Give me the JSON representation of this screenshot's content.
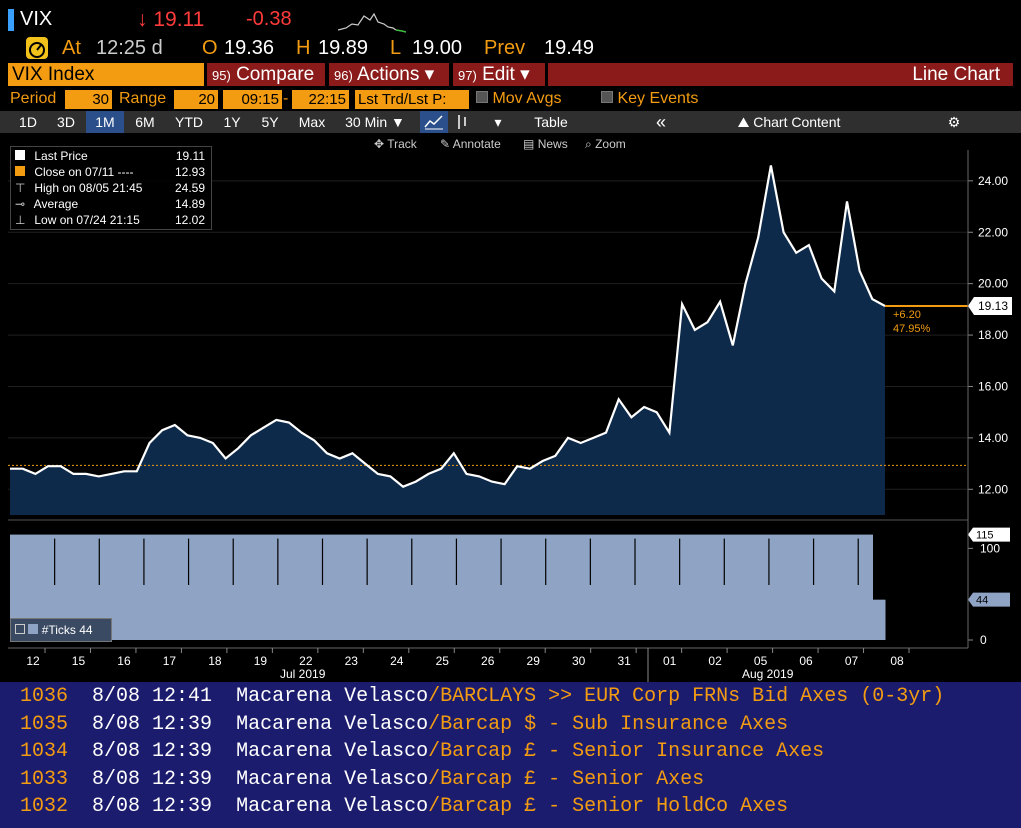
{
  "quote": {
    "ticker": "VIX",
    "last": "↓ 19.11",
    "change": "-0.38",
    "at_label": "At",
    "time": "12:25 d",
    "open_label": "O",
    "open": "19.36",
    "high_label": "H",
    "high": "19.89",
    "low_label": "L",
    "low": "19.00",
    "prev_label": "Prev",
    "prev": "19.49"
  },
  "menu": {
    "security": "VIX Index",
    "compare_num": "95)",
    "compare": "Compare",
    "actions_num": "96)",
    "actions": "Actions ▾",
    "edit_num": "97)",
    "edit": "Edit ▾",
    "chart_type": "Line Chart"
  },
  "period": {
    "period_label": "Period",
    "period_value": "30",
    "range_label": "Range",
    "range_value": "20",
    "start_time": "09:15",
    "dash": "-",
    "end_time": "22:15",
    "mode": "Lst Trd/Lst P:",
    "mov_avgs": "Mov Avgs",
    "key_events": "Key Events"
  },
  "toolbar": {
    "ranges": [
      "1D",
      "3D",
      "1M",
      "6M",
      "YTD",
      "1Y",
      "5Y",
      "Max"
    ],
    "active": "1M",
    "interval": "30 Min ▼",
    "table": "Table",
    "collapse": "«",
    "chart_content": "Chart Content"
  },
  "tools": {
    "track": "Track",
    "annotate": "Annotate",
    "news": "News",
    "zoom": "Zoom"
  },
  "legend": {
    "last_price_label": "Last Price",
    "last_price": "19.11",
    "close_label": "Close on 07/11 ----",
    "close": "12.93",
    "high_label": "High on 08/05 21:45",
    "high": "24.59",
    "average_label": "Average",
    "average": "14.89",
    "low_label": "Low on 07/24 21:15",
    "low": "12.02"
  },
  "annotations": {
    "price_tag": "19.13",
    "change_abs": "+6.20",
    "change_pct": "47.95%",
    "ticks_tag": "115",
    "ticks_current": "44",
    "ticks_legend": "#Ticks 44",
    "month_jul": "Jul 2019",
    "month_aug": "Aug 2019"
  },
  "colors": {
    "accent": "#f39c12",
    "line": "#ffffff",
    "area": "#0e2a4a",
    "volume": "#8fa3c4",
    "news_bg": "#1c1c6e",
    "menu_red": "#8b1a1a"
  },
  "chart_data": {
    "type": "area",
    "title": "",
    "y_axis_ticks": [
      "12.00",
      "14.00",
      "16.00",
      "18.00",
      "20.00",
      "22.00",
      "24.00"
    ],
    "ylim": [
      11,
      25.2
    ],
    "reference_line": {
      "label": "Close on 07/11",
      "value": 12.93
    },
    "x_ticks": [
      "12",
      "15",
      "16",
      "17",
      "18",
      "19",
      "22",
      "23",
      "24",
      "25",
      "26",
      "29",
      "30",
      "31",
      "01",
      "02",
      "05",
      "06",
      "07",
      "08"
    ],
    "x": [
      "12",
      "",
      "15",
      "",
      "16",
      "",
      "17",
      "",
      "18",
      "",
      "19",
      "",
      "22",
      "",
      "23",
      "",
      "24",
      "",
      "25",
      "",
      "26",
      "",
      "29",
      "",
      "30",
      "",
      "31",
      "",
      "01",
      "",
      "02",
      "",
      "05",
      "",
      "06",
      "",
      "07",
      ""
    ],
    "series": [
      {
        "values": [
          12.8,
          12.8,
          12.6,
          12.9,
          12.9,
          12.6,
          12.6,
          12.5,
          12.6,
          12.7,
          12.7,
          13.8,
          14.3,
          14.5,
          14.1,
          14.0,
          13.8,
          13.2,
          13.6,
          14.1,
          14.4,
          14.7,
          14.6,
          14.2,
          13.9,
          13.4,
          13.2,
          13.4,
          13.0,
          12.6,
          12.5,
          12.1,
          12.3,
          12.6,
          12.8,
          13.4,
          12.6,
          12.5,
          12.3,
          12.2,
          12.9,
          12.8,
          13.1,
          13.3,
          14.0,
          13.8,
          14.0,
          14.2,
          15.5,
          14.8,
          15.2,
          15.0,
          14.2,
          19.2,
          18.2,
          18.5,
          19.3,
          17.6,
          20.0,
          21.8,
          24.6,
          22.0,
          21.2,
          21.5,
          20.2,
          19.7,
          23.2,
          20.5,
          19.4,
          19.13
        ]
      }
    ],
    "volume_axis_ticks": [
      "0",
      "100"
    ],
    "volume": {
      "name": "#Ticks",
      "values": [
        115,
        115,
        115,
        115,
        115,
        115,
        115,
        115,
        115,
        115,
        115,
        115,
        115,
        115,
        115,
        115,
        115,
        115,
        115,
        115,
        115,
        115,
        115,
        115,
        115,
        115,
        115,
        115,
        115,
        115,
        115,
        115,
        115,
        115,
        115,
        115,
        115,
        115,
        115,
        115,
        115,
        115,
        115,
        115,
        115,
        115,
        115,
        115,
        115,
        115,
        115,
        115,
        115,
        115,
        115,
        115,
        115,
        115,
        115,
        115,
        115,
        115,
        115,
        115,
        115,
        115,
        115,
        115,
        115,
        44
      ]
    }
  },
  "news": [
    {
      "id": "1036",
      "time": "8/08 12:41",
      "author": "Macarena Velasco",
      "source": "/BARCLAYS",
      "headline": " >> EUR Corp FRNs Bid Axes (0-3yr)"
    },
    {
      "id": "1035",
      "time": "8/08 12:39",
      "author": "Macarena Velasco",
      "source": "/Barcap",
      "headline": " $ - Sub Insurance Axes"
    },
    {
      "id": "1034",
      "time": "8/08 12:39",
      "author": "Macarena Velasco",
      "source": "/Barcap",
      "headline": " £ - Senior Insurance Axes"
    },
    {
      "id": "1033",
      "time": "8/08 12:39",
      "author": "Macarena Velasco",
      "source": "/Barcap",
      "headline": " £ - Senior Axes"
    },
    {
      "id": "1032",
      "time": "8/08 12:39",
      "author": "Macarena Velasco",
      "source": "/Barcap",
      "headline": " £ - Senior HoldCo Axes"
    }
  ]
}
